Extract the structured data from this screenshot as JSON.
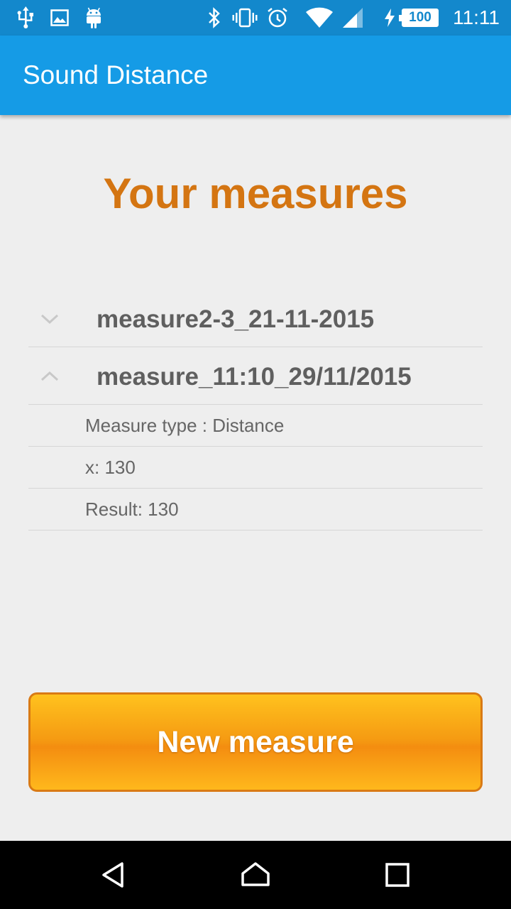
{
  "status_bar": {
    "time": "11:11",
    "battery_level": "100",
    "icons": [
      "usb-icon",
      "image-icon",
      "android-icon",
      "bluetooth-icon",
      "vibrate-icon",
      "alarm-icon",
      "wifi-icon",
      "signal-icon",
      "charging-icon",
      "battery-icon"
    ]
  },
  "app_bar": {
    "title": "Sound Distance"
  },
  "heading": "Your measures",
  "measures": [
    {
      "name": "measure2-3_21-11-2015",
      "expanded": false
    },
    {
      "name": "measure_11:10_29/11/2015",
      "expanded": true,
      "details": [
        "Measure type : Distance",
        "x: 130",
        "Result: 130"
      ]
    }
  ],
  "new_measure_button": {
    "label": "New measure"
  },
  "colors": {
    "status_bar": "#1388cc",
    "app_bar": "#159be6",
    "heading": "#d47512",
    "button_orange": "#f59a12",
    "background": "#eeeeee"
  },
  "nav_bar": {
    "icons": [
      "back-icon",
      "home-icon",
      "recents-icon"
    ]
  }
}
